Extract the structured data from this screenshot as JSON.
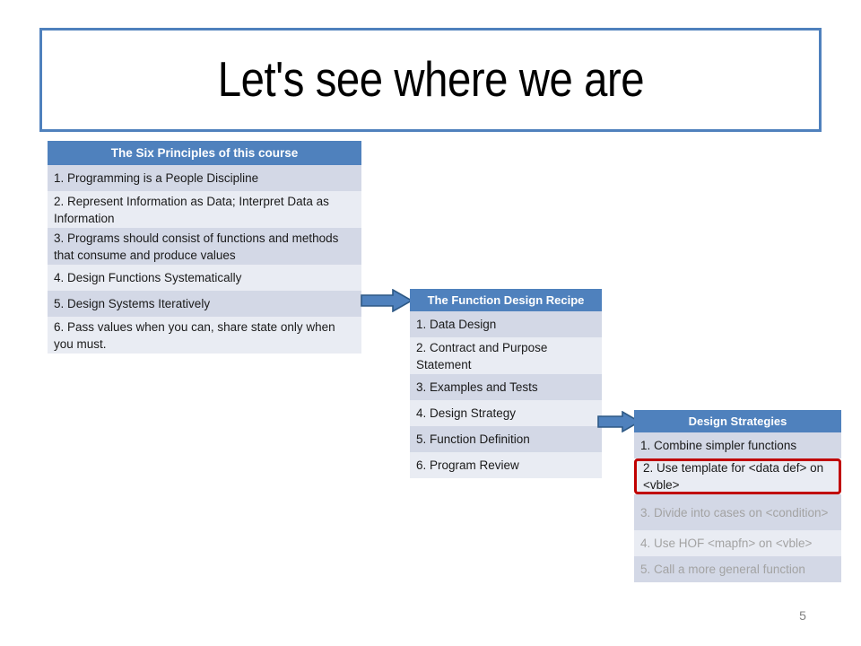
{
  "slide": {
    "title": "Let's see where we are",
    "page_number": "5",
    "accent_blue": "#4F81BD",
    "row_light": "#E9ECF3",
    "row_dark": "#D3D8E6",
    "highlight_red": "#C00000",
    "dim_text": "#A3A3A3"
  },
  "table_principles": {
    "header": "The Six Principles of this course",
    "rows": [
      {
        "text": "1. Programming  is a People Discipline",
        "lines": 1,
        "shade": "dark",
        "dim": false,
        "highlight": false
      },
      {
        "text": "2. Represent Information  as Data; Interpret Data as Information",
        "lines": 2,
        "shade": "light",
        "dim": false,
        "highlight": false
      },
      {
        "text": "3. Programs should consist of functions and methods that consume and produce values",
        "lines": 2,
        "shade": "dark",
        "dim": false,
        "highlight": false
      },
      {
        "text": "4. Design Functions Systematically",
        "lines": 1,
        "shade": "light",
        "dim": false,
        "highlight": false
      },
      {
        "text": "5. Design Systems Iteratively",
        "lines": 1,
        "shade": "dark",
        "dim": false,
        "highlight": false
      },
      {
        "text": "6. Pass values when you can, share state only when you must.",
        "lines": 2,
        "shade": "light",
        "dim": false,
        "highlight": false
      }
    ]
  },
  "table_recipe": {
    "header": "The Function Design Recipe",
    "rows": [
      {
        "text": "1. Data Design",
        "lines": 1,
        "shade": "dark",
        "dim": false,
        "highlight": false
      },
      {
        "text": "2. Contract and Purpose Statement",
        "lines": 2,
        "shade": "light",
        "dim": false,
        "highlight": false
      },
      {
        "text": "3. Examples and Tests",
        "lines": 1,
        "shade": "dark",
        "dim": false,
        "highlight": false
      },
      {
        "text": "4. Design Strategy",
        "lines": 1,
        "shade": "light",
        "dim": false,
        "highlight": false
      },
      {
        "text": "5. Function  Definition",
        "lines": 1,
        "shade": "dark",
        "dim": false,
        "highlight": false
      },
      {
        "text": "6. Program  Review",
        "lines": 1,
        "shade": "light",
        "dim": false,
        "highlight": false
      }
    ]
  },
  "table_strategies": {
    "header": "Design Strategies",
    "rows": [
      {
        "text": "1. Combine  simpler functions",
        "lines": 1,
        "shade": "dark",
        "dim": false,
        "highlight": false
      },
      {
        "text": "2. Use template  for <data def> on <vble>",
        "lines": 2,
        "shade": "light",
        "dim": false,
        "highlight": true
      },
      {
        "text": "3. Divide into cases on <condition>",
        "lines": 2,
        "shade": "dark",
        "dim": true,
        "highlight": false
      },
      {
        "text": "4. Use HOF <mapfn> on <vble>",
        "lines": 1,
        "shade": "light",
        "dim": true,
        "highlight": false
      },
      {
        "text": "5. Call a more general function",
        "lines": 1,
        "shade": "dark",
        "dim": true,
        "highlight": false
      }
    ]
  },
  "arrows": [
    {
      "name": "arrow-principles-to-recipe"
    },
    {
      "name": "arrow-recipe-to-strategies"
    }
  ]
}
